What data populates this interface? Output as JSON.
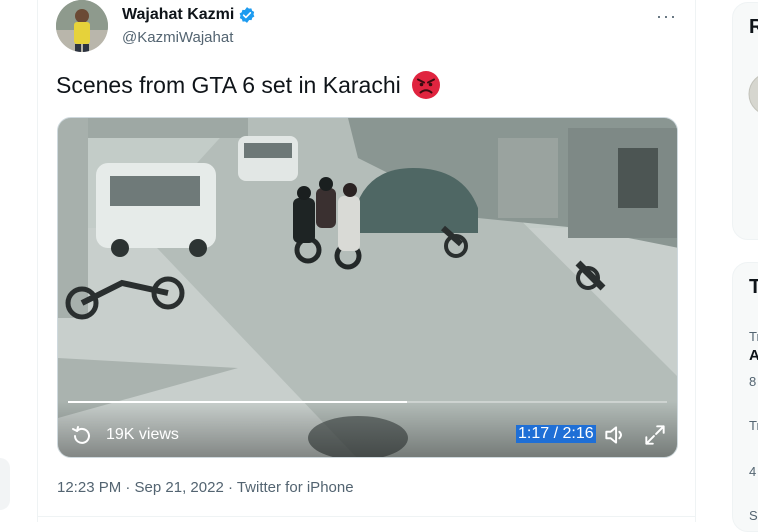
{
  "tweet": {
    "author_name": "Wajahat Kazmi",
    "author_handle": "@KazmiWajahat",
    "verified": true,
    "more_icon": "···",
    "text": "Scenes from GTA 6 set in Karachi",
    "emoji": "😡",
    "video": {
      "views": "19K views",
      "time": "1:17 / 2:16",
      "progress": 0.566
    },
    "timestamp": "12:23 PM · Sep 21, 2022 · Twitter for iPhone"
  },
  "sidebar": {
    "card1_letter": "R",
    "card2_letter": "T",
    "snippets": [
      "Tr",
      "A",
      "8",
      "Tr",
      "4",
      "S"
    ]
  },
  "colors": {
    "accent": "#1d9bf0",
    "text": "#0f1419",
    "secondary": "#536471",
    "border": "#eff3f4",
    "angry_face": "#e0243f"
  }
}
